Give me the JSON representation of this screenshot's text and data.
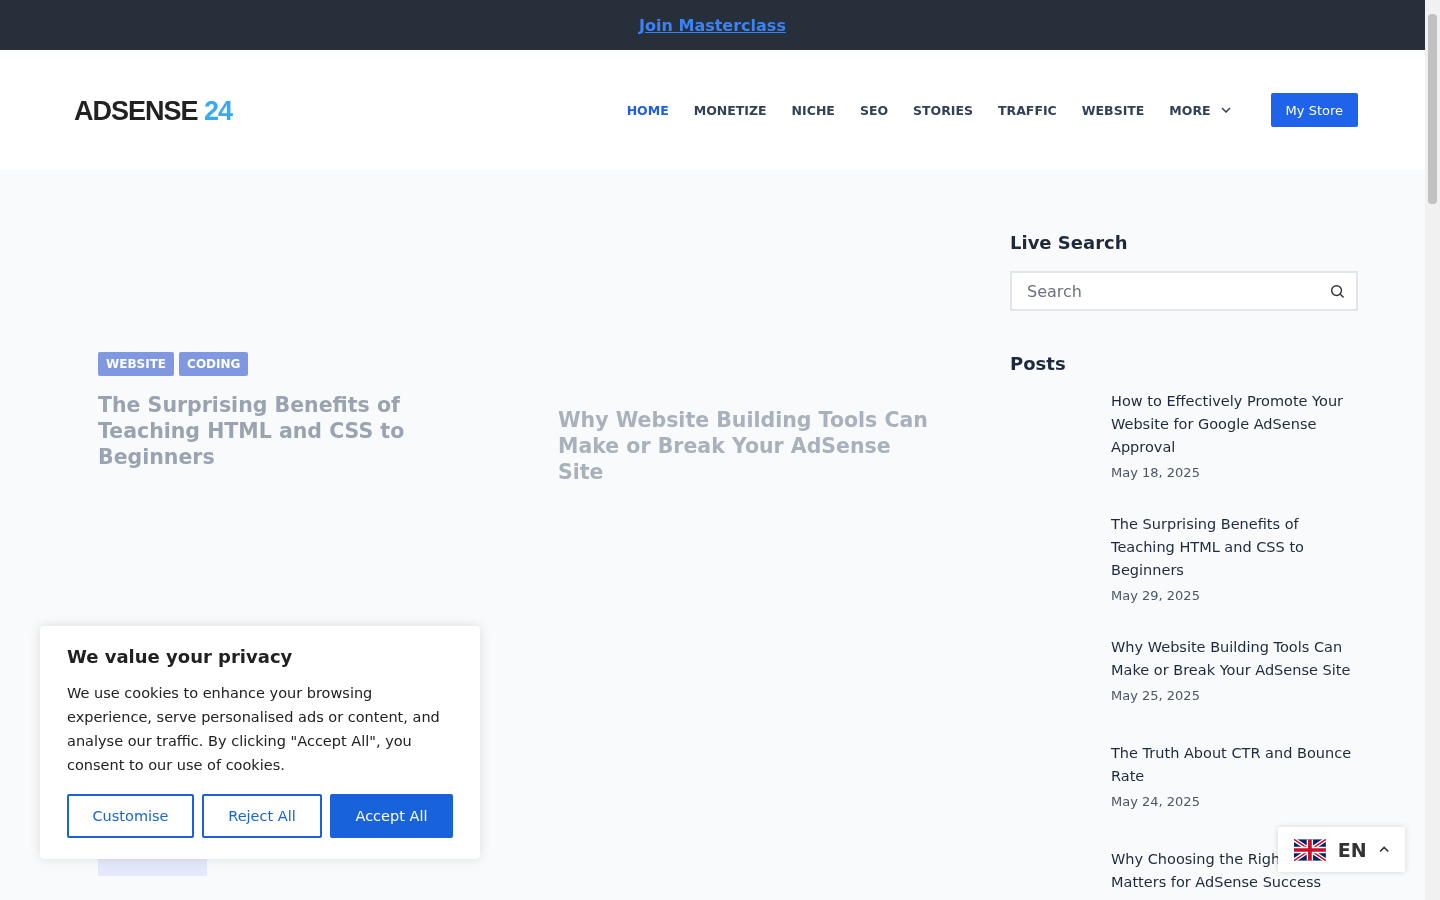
{
  "top_bar": {
    "link": "Join Masterclass"
  },
  "header": {
    "logo": {
      "word": "ADSENSE",
      "number": "24"
    },
    "nav": [
      {
        "label": "HOME",
        "selected": true,
        "dropdown": false
      },
      {
        "label": "MONETIZE",
        "selected": false,
        "dropdown": false
      },
      {
        "label": "NICHE",
        "selected": false,
        "dropdown": false
      },
      {
        "label": "SEO",
        "selected": false,
        "dropdown": false
      },
      {
        "label": "STORIES",
        "selected": false,
        "dropdown": false
      },
      {
        "label": "TRAFFIC",
        "selected": false,
        "dropdown": false
      },
      {
        "label": "WEBSITE",
        "selected": false,
        "dropdown": false
      },
      {
        "label": "MORE",
        "selected": false,
        "dropdown": true
      }
    ],
    "button": "My Store"
  },
  "cards": [
    {
      "tags": [
        "WEBSITE",
        "CODING"
      ],
      "title": "The Surprising Benefits of Teaching HTML and CSS to Beginners",
      "faded": false
    },
    {
      "title": "Why Website Building Tools Can Make or Break Your AdSense Site",
      "faded": true
    }
  ],
  "sidebar": {
    "search_title": "Live Search",
    "search": {
      "placeholder": "Search"
    },
    "posts_title": "Posts",
    "posts": [
      {
        "title_lines": [
          "How to Effectively Promote Your Website for Google AdSense Approval"
        ],
        "date": "May 18, 2025"
      },
      {
        "title_lines": [
          "The Surprising Benefits of Teaching HTML and CSS to Beginners"
        ],
        "date": "May 29, 2025"
      },
      {
        "title_lines": [
          "Why Website Building Tools Can Make or Break Your AdSense Site"
        ],
        "date": "May 25, 2025"
      },
      {
        "title_lines": [
          "The Truth About CTR and Bounce Rate"
        ],
        "date": "May 24, 2025"
      },
      {
        "title_lines": [
          "Why Choosing the Righ",
          "Matters for AdSense Success"
        ]
      }
    ]
  },
  "cookie_banner": {
    "title": "We value your privacy",
    "text": "We use cookies to enhance your browsing experience, serve personalised ads or content, and analyse our traffic. By clicking \"Accept All\", you consent to our use of cookies.",
    "buttons": [
      {
        "label": "Customise",
        "primary": false
      },
      {
        "label": "Reject All",
        "primary": false
      },
      {
        "label": "Accept All",
        "primary": true
      }
    ]
  },
  "language": {
    "code": "EN"
  }
}
